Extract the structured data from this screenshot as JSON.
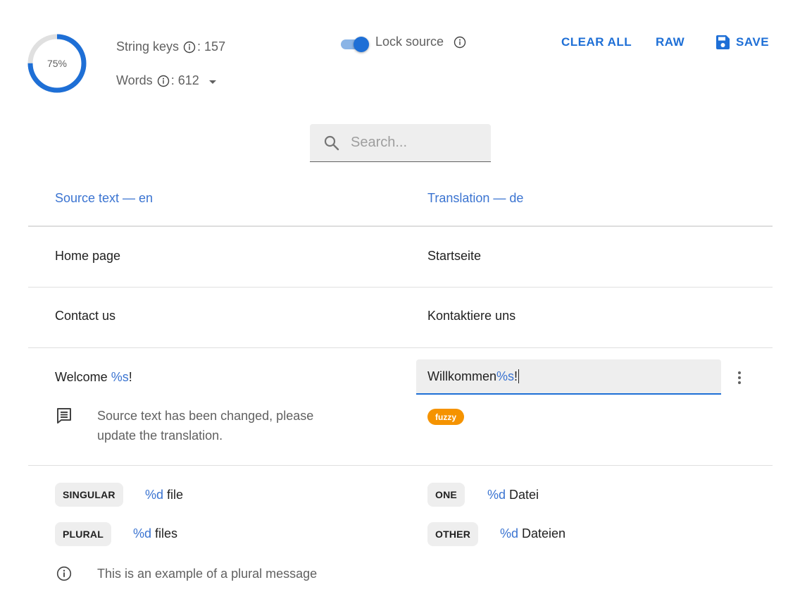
{
  "header": {
    "progress_percent": 75,
    "progress_label": "75%",
    "string_keys_label": "String keys",
    "string_keys_value": ": 157",
    "words_label": "Words",
    "words_value": ": 612",
    "lock_source_label": "Lock source",
    "lock_source_on": true,
    "clear_all_label": "CLEAR ALL",
    "raw_label": "RAW",
    "save_label": "SAVE"
  },
  "search": {
    "placeholder": "Search...",
    "value": ""
  },
  "columns": {
    "source": "Source text — en",
    "translation": "Translation — de"
  },
  "rows": [
    {
      "source": "Home page",
      "translation": "Startseite"
    },
    {
      "source": "Contact us",
      "translation": "Kontaktiere uns"
    }
  ],
  "active_row": {
    "source_prefix": "Welcome ",
    "source_placeholder": "%s",
    "source_suffix": "!",
    "translation_prefix": "Willkommen ",
    "translation_placeholder": "%s",
    "translation_suffix": "!",
    "note": [
      "Source text has been changed, please",
      "update the translation."
    ],
    "badge": "fuzzy"
  },
  "plural_row": {
    "source_forms": [
      {
        "label": "SINGULAR",
        "placeholder": "%d",
        "text": " file"
      },
      {
        "label": "PLURAL",
        "placeholder": "%d",
        "text": " files"
      }
    ],
    "translation_forms": [
      {
        "label": "ONE",
        "placeholder": "%d",
        "text": " Datei"
      },
      {
        "label": "OTHER",
        "placeholder": "%d",
        "text": " Dateien"
      }
    ],
    "comment": "This is an example of a plural message"
  },
  "colors": {
    "accent": "#1e6fd6",
    "link_text": "#3b74d1",
    "fuzzy_badge": "#f59300"
  },
  "icons": {
    "info": "info-circle-icon",
    "save": "floppy-disk-icon",
    "search": "search-icon",
    "comment": "comment-icon",
    "more": "more-vertical-icon"
  }
}
